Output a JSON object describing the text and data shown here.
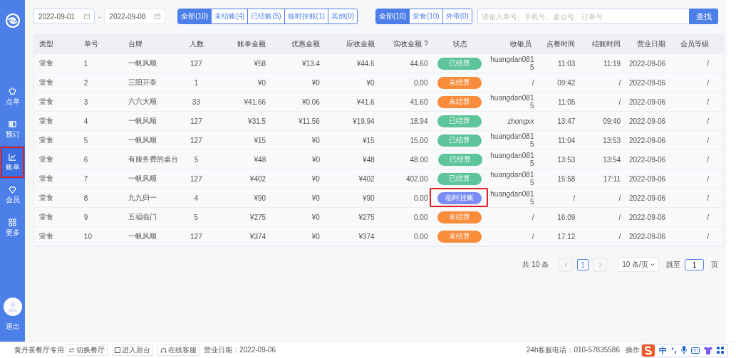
{
  "sidebar": {
    "items": [
      {
        "label": "点单",
        "selected": false,
        "highlighted": false
      },
      {
        "label": "预订",
        "selected": false,
        "highlighted": false
      },
      {
        "label": "账单",
        "selected": true,
        "highlighted": true
      },
      {
        "label": "会员",
        "selected": false,
        "highlighted": false
      },
      {
        "label": "更多",
        "selected": false,
        "highlighted": false
      }
    ],
    "logout": "退出"
  },
  "filters": {
    "date_from": "2022-09-01",
    "separator": "-",
    "date_to": "2022-09-08",
    "status_tabs": [
      {
        "label": "全部(10)",
        "selected": true
      },
      {
        "label": "未结账(4)",
        "selected": false
      },
      {
        "label": "已结账(5)",
        "selected": false
      },
      {
        "label": "临时挂账(1)",
        "selected": false
      },
      {
        "label": "其他(0)",
        "selected": false
      }
    ],
    "type_tabs": [
      {
        "label": "全部(10)",
        "selected": true
      },
      {
        "label": "堂食(10)",
        "selected": false
      },
      {
        "label": "外带(0)",
        "selected": false
      }
    ],
    "search": {
      "placeholder": "请输入单号、手机号、桌台号、订单号",
      "button": "查找"
    }
  },
  "table": {
    "columns": [
      "类型",
      "单号",
      "台牌",
      "人数",
      "账单金额",
      "优惠金额",
      "应收金额",
      "实收金额 ?",
      "状态",
      "收银员",
      "点餐时间",
      "结账时间",
      "营业日期",
      "会员等级"
    ],
    "rows": [
      {
        "cells": [
          "堂食",
          "1",
          "一帆风顺",
          "127",
          "¥58",
          "¥13.4",
          "¥44.6",
          "44.60"
        ],
        "status": {
          "label": "已结算",
          "kind": "settled"
        },
        "highlighted": false,
        "rest": [
          "huangdan0815",
          "11:03",
          "11:19",
          "2022-09-06",
          "/"
        ]
      },
      {
        "cells": [
          "堂食",
          "2",
          "三阳开泰",
          "1",
          "¥0",
          "¥0",
          "¥0",
          "0.00"
        ],
        "status": {
          "label": "未结算",
          "kind": "unsettled"
        },
        "highlighted": false,
        "rest": [
          "/",
          "09:42",
          "/",
          "2022-09-06",
          "/"
        ]
      },
      {
        "cells": [
          "堂食",
          "3",
          "六六大顺",
          "33",
          "¥41.66",
          "¥0.06",
          "¥41.6",
          "41.60"
        ],
        "status": {
          "label": "未结算",
          "kind": "unsettled"
        },
        "highlighted": false,
        "rest": [
          "huangdan0815",
          "11:05",
          "/",
          "2022-09-06",
          "/"
        ]
      },
      {
        "cells": [
          "堂食",
          "4",
          "一帆风顺",
          "127",
          "¥31.5",
          "¥11.56",
          "¥19.94",
          "18.94"
        ],
        "status": {
          "label": "已结算",
          "kind": "settled"
        },
        "highlighted": false,
        "rest": [
          "zhongxx",
          "13:47",
          "09:40",
          "2022-09-06",
          "/"
        ]
      },
      {
        "cells": [
          "堂食",
          "5",
          "一帆风顺",
          "127",
          "¥15",
          "¥0",
          "¥15",
          "15.00"
        ],
        "status": {
          "label": "已结算",
          "kind": "settled"
        },
        "highlighted": false,
        "rest": [
          "huangdan0815",
          "11:04",
          "13:53",
          "2022-09-06",
          "/"
        ]
      },
      {
        "cells": [
          "堂食",
          "6",
          "有服务费的桌台",
          "5",
          "¥48",
          "¥0",
          "¥48",
          "48.00"
        ],
        "status": {
          "label": "已结算",
          "kind": "settled"
        },
        "highlighted": false,
        "rest": [
          "huangdan0815",
          "13:53",
          "13:54",
          "2022-09-06",
          "/"
        ]
      },
      {
        "cells": [
          "堂食",
          "7",
          "一帆风顺",
          "127",
          "¥402",
          "¥0",
          "¥402",
          "402.00"
        ],
        "status": {
          "label": "已结算",
          "kind": "settled"
        },
        "highlighted": false,
        "rest": [
          "huangdan0815",
          "15:58",
          "17:11",
          "2022-09-06",
          "/"
        ]
      },
      {
        "cells": [
          "堂食",
          "8",
          "九九归一",
          "4",
          "¥90",
          "¥0",
          "¥90",
          "0.00"
        ],
        "status": {
          "label": "临时挂账",
          "kind": "pending"
        },
        "highlighted": true,
        "rest": [
          "huangdan0815",
          "/",
          "/",
          "2022-09-06",
          "/"
        ]
      },
      {
        "cells": [
          "堂食",
          "9",
          "五福临门",
          "5",
          "¥275",
          "¥0",
          "¥275",
          "0.00"
        ],
        "status": {
          "label": "未结算",
          "kind": "unsettled"
        },
        "highlighted": false,
        "rest": [
          "/",
          "16:09",
          "/",
          "2022-09-06",
          "/"
        ]
      },
      {
        "cells": [
          "堂食",
          "10",
          "一帆风顺",
          "127",
          "¥374",
          "¥0",
          "¥374",
          "0.00"
        ],
        "status": {
          "label": "未结算",
          "kind": "unsettled"
        },
        "highlighted": false,
        "rest": [
          "/",
          "17:12",
          "/",
          "2022-09-06",
          "/"
        ]
      }
    ]
  },
  "pagination": {
    "total": "共 10 条",
    "pages": [
      {
        "label": "1",
        "selected": true
      }
    ],
    "page_size": "10 条/页",
    "goto_label": "跳至",
    "goto_value": "1",
    "page_unit": "页"
  },
  "footer": {
    "store": "黄丹茶餐厅专用",
    "buttons": [
      {
        "label": "切换餐厅"
      },
      {
        "label": "进入后台"
      },
      {
        "label": "在线客服"
      }
    ],
    "business_date": "营业日期：2022-09-06",
    "hotline": "24h客服电话：010-57835586",
    "operation": "操作",
    "ime_mode": "中"
  }
}
